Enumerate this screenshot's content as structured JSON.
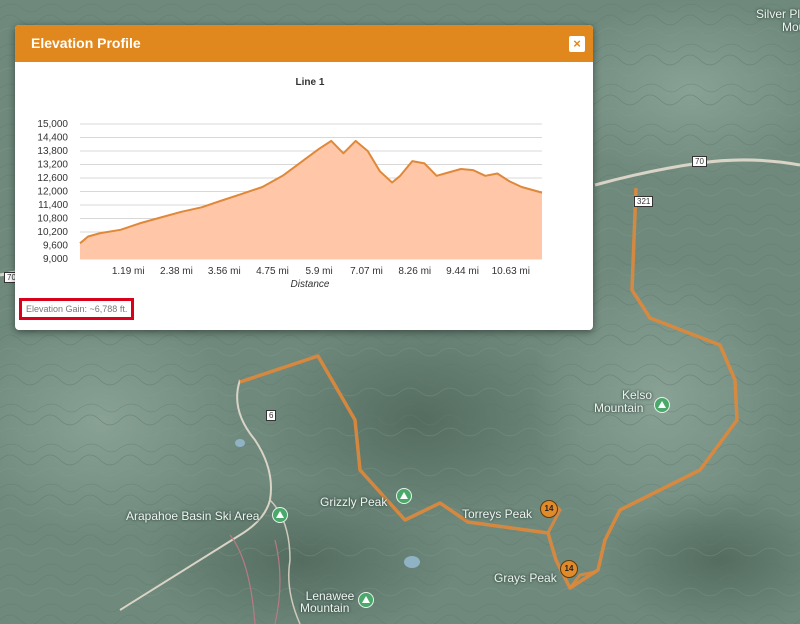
{
  "panel": {
    "title": "Elevation Profile",
    "close_label": "×",
    "elevation_gain": "Elevation Gain: ~6,788 ft."
  },
  "map": {
    "labels": {
      "silver_plume": "Silver Pl",
      "silver_plume_2": "Mou",
      "kelso": "Kelso",
      "kelso_2": "Mountain",
      "grizzly": "Grizzly Peak",
      "torreys": "Torreys Peak",
      "grays": "Grays Peak",
      "arapahoe": "Arapahoe Basin Ski Area",
      "lenawee": "Lenawee",
      "lenawee_2": "Mountain"
    },
    "highways": {
      "i70": "70",
      "r321": "321",
      "r6": "6",
      "i70_west": "70"
    },
    "route_badges": {
      "torreys": "14",
      "grays": "14"
    },
    "colors": {
      "route": "#e0883a",
      "terrain": "#6f8a7d"
    }
  },
  "chart_data": {
    "type": "area",
    "title": "Line 1",
    "xlabel": "Distance",
    "ylabel": "",
    "ylim": [
      9000,
      15000
    ],
    "xlim": [
      0,
      11.4
    ],
    "y_ticks": [
      9000,
      9600,
      10200,
      10800,
      11400,
      12000,
      12600,
      13200,
      13800,
      14400,
      15000
    ],
    "y_tick_labels": [
      "9,000",
      "9,600",
      "10,200",
      "10,800",
      "11,400",
      "12,000",
      "12,600",
      "13,200",
      "13,800",
      "14,400",
      "15,000"
    ],
    "x_ticks": [
      1.19,
      2.38,
      3.56,
      4.75,
      5.9,
      7.07,
      8.26,
      9.44,
      10.63
    ],
    "x_tick_labels": [
      "1.19 mi",
      "2.38 mi",
      "3.56 mi",
      "4.75 mi",
      "5.9 mi",
      "7.07 mi",
      "8.26 mi",
      "9.44 mi",
      "10.63 mi"
    ],
    "grid": true,
    "series": [
      {
        "color": "#e0883a",
        "fill": "#ffc7a8",
        "x": [
          0,
          0.2,
          0.5,
          1.0,
          1.5,
          2.0,
          2.5,
          3.0,
          3.5,
          4.0,
          4.5,
          5.0,
          5.3,
          5.6,
          5.9,
          6.2,
          6.5,
          6.8,
          7.1,
          7.4,
          7.7,
          7.9,
          8.2,
          8.5,
          8.8,
          9.1,
          9.4,
          9.7,
          10.0,
          10.3,
          10.6,
          10.9,
          11.2,
          11.4
        ],
        "y": [
          9700,
          10000,
          10150,
          10300,
          10600,
          10850,
          11100,
          11300,
          11600,
          11900,
          12200,
          12700,
          13100,
          13500,
          13900,
          14250,
          13700,
          14250,
          13800,
          12900,
          12400,
          12700,
          13350,
          13250,
          12700,
          12850,
          13000,
          12950,
          12700,
          12800,
          12450,
          12200,
          12050,
          11950
        ]
      }
    ]
  }
}
